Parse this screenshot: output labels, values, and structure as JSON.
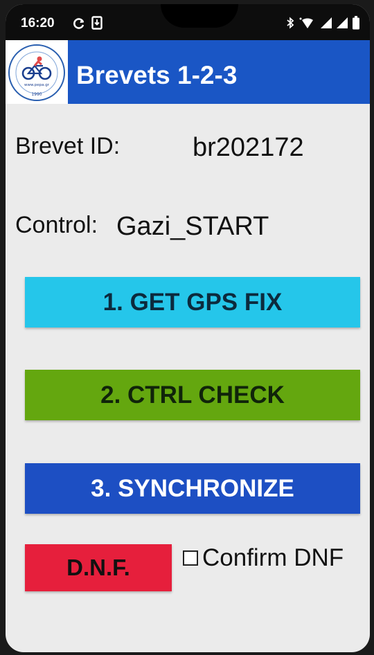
{
  "status_bar": {
    "time": "16:20",
    "left_icons": [
      "sync-icon",
      "download-icon"
    ],
    "right_icons": [
      "bluetooth-icon",
      "wifi-icon",
      "signal-icon",
      "signal-icon",
      "battery-icon"
    ]
  },
  "app_bar": {
    "title": "Brevets 1-2-3",
    "logo_text": "www.pepa.gr",
    "logo_year": "1990",
    "color": "#1a56c5"
  },
  "fields": {
    "brevet_label": "Brevet ID:",
    "brevet_value": "br202172",
    "control_label": "Control:",
    "control_value": "Gazi_START"
  },
  "buttons": {
    "gps": {
      "label": "1. GET GPS FIX",
      "color": "#25c6ea"
    },
    "ctrl": {
      "label": "2. CTRL CHECK",
      "color": "#64a70f"
    },
    "sync": {
      "label": "3. SYNCHRONIZE",
      "color": "#1d4fc3"
    },
    "dnf": {
      "label": "D.N.F.",
      "color": "#e61f3c"
    }
  },
  "confirm_dnf": {
    "label": "Confirm DNF",
    "checked": false
  }
}
